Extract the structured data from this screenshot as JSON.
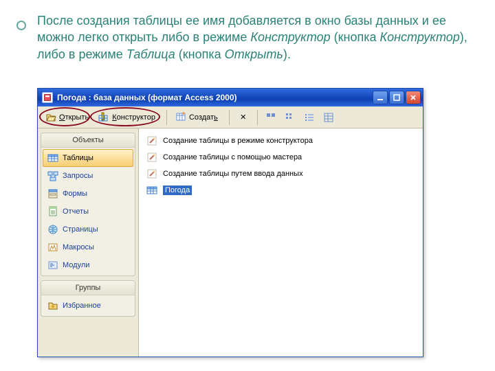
{
  "caption": {
    "p1a": "После создания таблицы ее имя добавляется в окно базы данных и ее можно легко открыть либо в режиме ",
    "p1b": "Конструктор",
    "p1c": " (кнопка ",
    "p1d": "Конструктор",
    "p1e": "), либо в режиме ",
    "p1f": "Таблица",
    "p1g": " (кнопка ",
    "p1h": "Открыть",
    "p1i": ")."
  },
  "window": {
    "title": "Погода : база данных (формат Access 2000)"
  },
  "toolbar": {
    "open": "Открыть",
    "design": "Конструктор",
    "new": "Создать",
    "open_u": "О",
    "design_u": "К",
    "new_u": "ь"
  },
  "sidebar": {
    "objects_header": "Объекты",
    "groups_header": "Группы",
    "items": [
      {
        "label": "Таблицы"
      },
      {
        "label": "Запросы"
      },
      {
        "label": "Формы"
      },
      {
        "label": "Отчеты"
      },
      {
        "label": "Страницы"
      },
      {
        "label": "Макросы"
      },
      {
        "label": "Модули"
      }
    ],
    "favorites": "Избранное"
  },
  "main": {
    "items": [
      {
        "label": "Создание таблицы в режиме конструктора"
      },
      {
        "label": "Создание таблицы с помощью мастера"
      },
      {
        "label": "Создание таблицы путем ввода данных"
      },
      {
        "label": "Погода"
      }
    ]
  }
}
